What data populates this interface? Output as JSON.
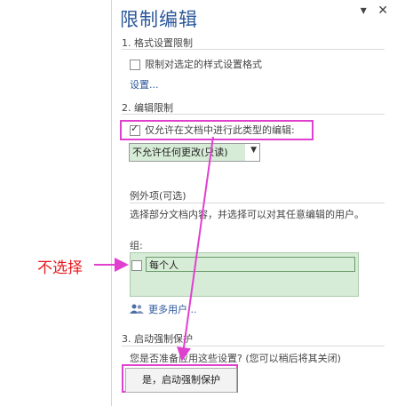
{
  "panel": {
    "title": "限制编辑",
    "window_buttons": [
      "▾",
      "✕"
    ]
  },
  "section1": {
    "heading": "1. 格式设置限制",
    "checkbox_label": "限制对选定的样式设置格式",
    "settings_link": "设置..."
  },
  "section2": {
    "heading": "2. 编辑限制",
    "checkbox_label": "仅允许在文档中进行此类型的编辑:",
    "dropdown_value": "不允许任何更改(只读)",
    "exceptions_heading": "例外项(可选)",
    "exceptions_desc": "选择部分文档内容，并选择可以对其任意编辑的用户。",
    "group_label": "组:",
    "group_item": "每个人",
    "more_users": "更多用户..."
  },
  "section3": {
    "heading": "3. 启动强制保护",
    "question": "您是否准备应用这些设置? (您可以稍后将其关闭)",
    "button": "是，启动强制保护"
  },
  "annotation": {
    "text": "不选择",
    "color": "#e8191e",
    "highlight_color": "#e040d0"
  }
}
